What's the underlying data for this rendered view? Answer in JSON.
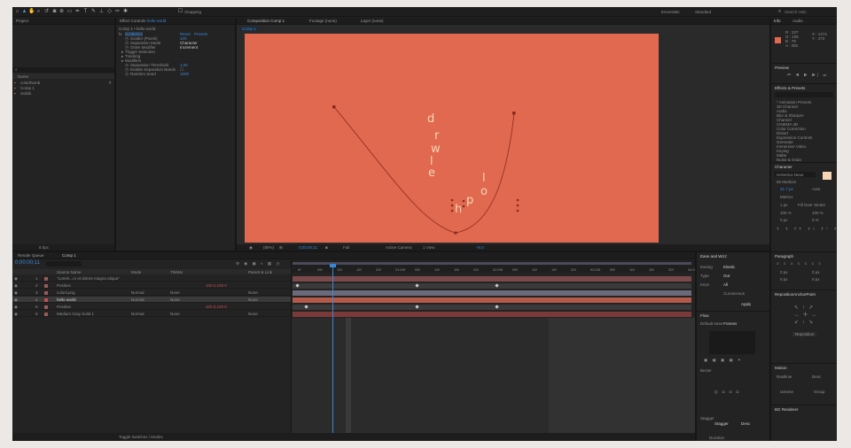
{
  "toolbar": {
    "snapping": "Snapping",
    "workspaces": [
      "Essentials",
      "Standard"
    ],
    "search_placeholder": "Search Help"
  },
  "project_panel": {
    "tab": "Project",
    "name_header": "Name",
    "items": [
      "colorthumb",
      "Comp 1",
      "Solids"
    ],
    "bpc": "8 bpc"
  },
  "effect_controls": {
    "tab": "Effect Controls",
    "layer": "hello world",
    "breadcrumb": "Comp 1 • hello world",
    "group": "Scatterize",
    "reset": "Reset",
    "presets": "Presets",
    "properties": [
      {
        "name": "Scatter (Pixels)",
        "value": "100"
      },
      {
        "name": "Separation Mode",
        "value": "Character"
      },
      {
        "name": "Order Modifier",
        "value": "Increment"
      },
      {
        "name": "Trigger Selection",
        "value": ""
      },
      {
        "name": "Tracking",
        "value": ""
      },
      {
        "name": "Modifiers",
        "value": ""
      },
      {
        "name": "Separation Threshold",
        "value": "1.00"
      },
      {
        "name": "Enable Separation Bands",
        "value": ""
      },
      {
        "name": "Random Seed",
        "value": "1000"
      }
    ]
  },
  "composition": {
    "tabs": [
      "Composition Comp 1",
      "Footage (none)",
      "Layer (none)"
    ],
    "comp_label": "Comp 1",
    "background_color": "#e0694f",
    "letters": [
      "d",
      "r",
      "w",
      "l",
      "e",
      "h",
      "p",
      "o",
      "l"
    ],
    "zoom": "(80%)",
    "timecode": "0;00;00;11",
    "resolution": "Full",
    "camera": "Active Camera",
    "views": "1 View",
    "exposure": "+0.0"
  },
  "timeline": {
    "tabs": [
      "Render Queue",
      "Comp 1"
    ],
    "current_time": "0;00;00;11",
    "column_headers": [
      "Source Name",
      "Mode",
      "TrkMat",
      "Parent & Link"
    ],
    "layers": [
      {
        "num": "1",
        "name": "\"Lorem...ro et dolore magna aliqua\"",
        "mode": "",
        "trk": "",
        "parent": ""
      },
      {
        "num": "2",
        "name": "Position",
        "mode": "",
        "trk": "",
        "parent": ""
      },
      {
        "num": "3",
        "name": "colorli.png",
        "mode": "Normal",
        "trk": "None",
        "parent": "None"
      },
      {
        "num": "4",
        "name": "hello world",
        "mode": "Normal",
        "trk": "None",
        "parent": "None"
      },
      {
        "num": "5",
        "name": "Position",
        "mode": "",
        "trk": "",
        "parent": ""
      },
      {
        "num": "6",
        "name": "Medium Gray Solid 1",
        "mode": "Normal",
        "trk": "None",
        "parent": "None"
      }
    ],
    "value_label": "100.0,100.0",
    "ruler": [
      "0f",
      "05f",
      "10f",
      "15f",
      "20f",
      "01:00f",
      "05f",
      "10f",
      "15f",
      "20f",
      "02:00f",
      "05f",
      "10f",
      "15f",
      "20f",
      "03:00f",
      "05f",
      "10f",
      "15f",
      "20f",
      "04:00f"
    ],
    "modes_label": "Toggle Switches / Modes"
  },
  "ease_wizard": {
    "title": "Ease and Wizz",
    "easing_label": "Easing",
    "easing": "Elastic",
    "type_label": "Type",
    "type": "Out",
    "keys_label": "Keys",
    "keys": "All",
    "curvaceous": "Curvaceous",
    "apply": "Apply"
  },
  "info_panel": {
    "tabs": [
      "Info",
      "Audio"
    ],
    "r": "R : 227",
    "g": "G : 105",
    "b": "B : 79",
    "a": "A : 255",
    "x": "X : 1474",
    "y": "Y : 473",
    "swatch": "#e0694f"
  },
  "preview": {
    "title": "Preview"
  },
  "effects_presets": {
    "title": "Effects & Presets",
    "items": [
      "* Animation Presets",
      "3D Channel",
      "Audio",
      "Blur & Sharpen",
      "Channel",
      "CINEMA 4D",
      "Color Correction",
      "Distort",
      "Expression Controls",
      "Generate",
      "Immersive Video",
      "Keying",
      "Matte",
      "Noise & Grain"
    ]
  },
  "character": {
    "title": "Character",
    "font": "Helvetica Neue",
    "style": "65 Medium",
    "size": "31.7 px",
    "tracking": "Metrics",
    "leading": "Auto",
    "stroke": "1 px",
    "stroke_mode": "Fill Over Stroke",
    "scale_v": "100 %",
    "scale_h": "100 %",
    "baseline": "0 px",
    "tsume": "0 %"
  },
  "paragraph": {
    "title": "Paragraph",
    "indent_values": [
      "0 px",
      "0 px",
      "0 px",
      "0 px"
    ]
  },
  "repositioner": {
    "title": "RepositionAnchorPoint",
    "button": "Reposition"
  },
  "flow": {
    "title": "Flow",
    "default_ease": "Default ease",
    "ease_value": "Frames",
    "bezier": "Bezier",
    "stagger": "Stagger",
    "duration": "Duration",
    "desc": "Desc",
    "none": "None"
  },
  "motion2": {
    "title": "Motion",
    "items": [
      "Rastlinie",
      "Desc",
      "Iamene",
      "Group"
    ]
  },
  "bg_renderer": {
    "title": "BG Renderer"
  }
}
